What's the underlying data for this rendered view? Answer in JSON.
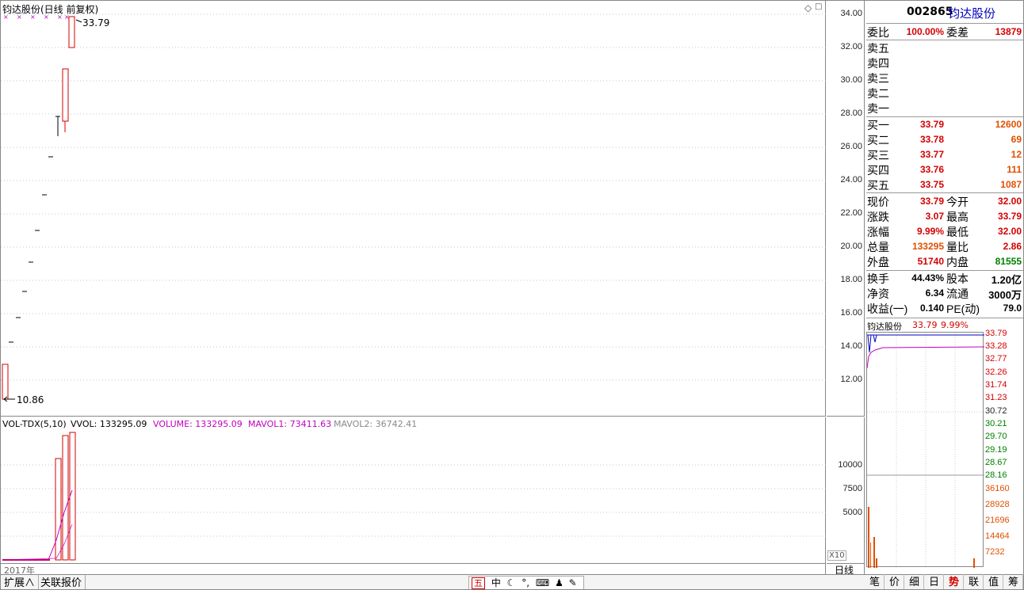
{
  "chart": {
    "title": "钧达股份(日线 前复权)",
    "high_label": "33.79",
    "low_label": "10.86",
    "price_axis": [
      "34.00",
      "32.00",
      "30.00",
      "28.00",
      "26.00",
      "24.00",
      "22.00",
      "20.00",
      "18.00",
      "16.00",
      "14.00",
      "12.00"
    ],
    "year_label": "2017年",
    "period_label": "日线"
  },
  "volume": {
    "indicator": "VOL-TDX(5,10)",
    "vvol": "VVOL: 133295.09",
    "volume": "VOLUME: 133295.09",
    "mavol1": "MAVOL1: 73411.63",
    "mavol2": "MAVOL2: 36742.41",
    "axis": [
      "10000",
      "7500",
      "5000"
    ],
    "scale": "X10"
  },
  "quote": {
    "code": "002865",
    "name": "钧达股份",
    "weibi_label": "委比",
    "weibi": "100.00%",
    "weicha_label": "委差",
    "weicha": "13879",
    "sell": [
      {
        "label": "卖五"
      },
      {
        "label": "卖四"
      },
      {
        "label": "卖三"
      },
      {
        "label": "卖二"
      },
      {
        "label": "卖一"
      }
    ],
    "buy": [
      {
        "label": "买一",
        "price": "33.79",
        "vol": "12600"
      },
      {
        "label": "买二",
        "price": "33.78",
        "vol": "69"
      },
      {
        "label": "买三",
        "price": "33.77",
        "vol": "12"
      },
      {
        "label": "买四",
        "price": "33.76",
        "vol": "111"
      },
      {
        "label": "买五",
        "price": "33.75",
        "vol": "1087"
      }
    ],
    "stats": [
      {
        "l1": "现价",
        "v1": "33.79",
        "l2": "今开",
        "v2": "32.00"
      },
      {
        "l1": "涨跌",
        "v1": "3.07",
        "l2": "最高",
        "v2": "33.79"
      },
      {
        "l1": "涨幅",
        "v1": "9.99%",
        "l2": "最低",
        "v2": "32.00"
      },
      {
        "l1": "总量",
        "v1": "133295",
        "l2": "量比",
        "v2": "2.86"
      },
      {
        "l1": "外盘",
        "v1": "51740",
        "l2": "内盘",
        "v2": "81555"
      }
    ],
    "fund": [
      {
        "l1": "换手",
        "v1": "44.43%",
        "l2": "股本",
        "v2": "1.20亿"
      },
      {
        "l1": "净资",
        "v1": "6.34",
        "l2": "流通",
        "v2": "3000万"
      },
      {
        "l1": "收益(一)",
        "v1": "0.140",
        "l2": "PE(动)",
        "v2": "79.0"
      }
    ]
  },
  "mini": {
    "name": "钧达股份",
    "price": "33.79",
    "pct": "9.99%",
    "axis": [
      "33.79",
      "33.28",
      "32.77",
      "32.26",
      "31.74",
      "31.23",
      "30.72",
      "30.21",
      "29.70",
      "29.19",
      "28.67",
      "28.16"
    ],
    "vol_axis": [
      "36160",
      "28928",
      "21696",
      "14464",
      "7232"
    ]
  },
  "bottom": {
    "expand": "扩展∧",
    "related": "关联报价",
    "toolbar_first": "五",
    "toolbar_second": "中",
    "tabs": [
      "笔",
      "价",
      "细",
      "日",
      "势",
      "联",
      "值",
      "筹"
    ]
  },
  "colors": {
    "up": "#d40000",
    "down": "#008000",
    "accent": "#e05000",
    "blue": "#0000c0",
    "ma": "#c000c0"
  }
}
